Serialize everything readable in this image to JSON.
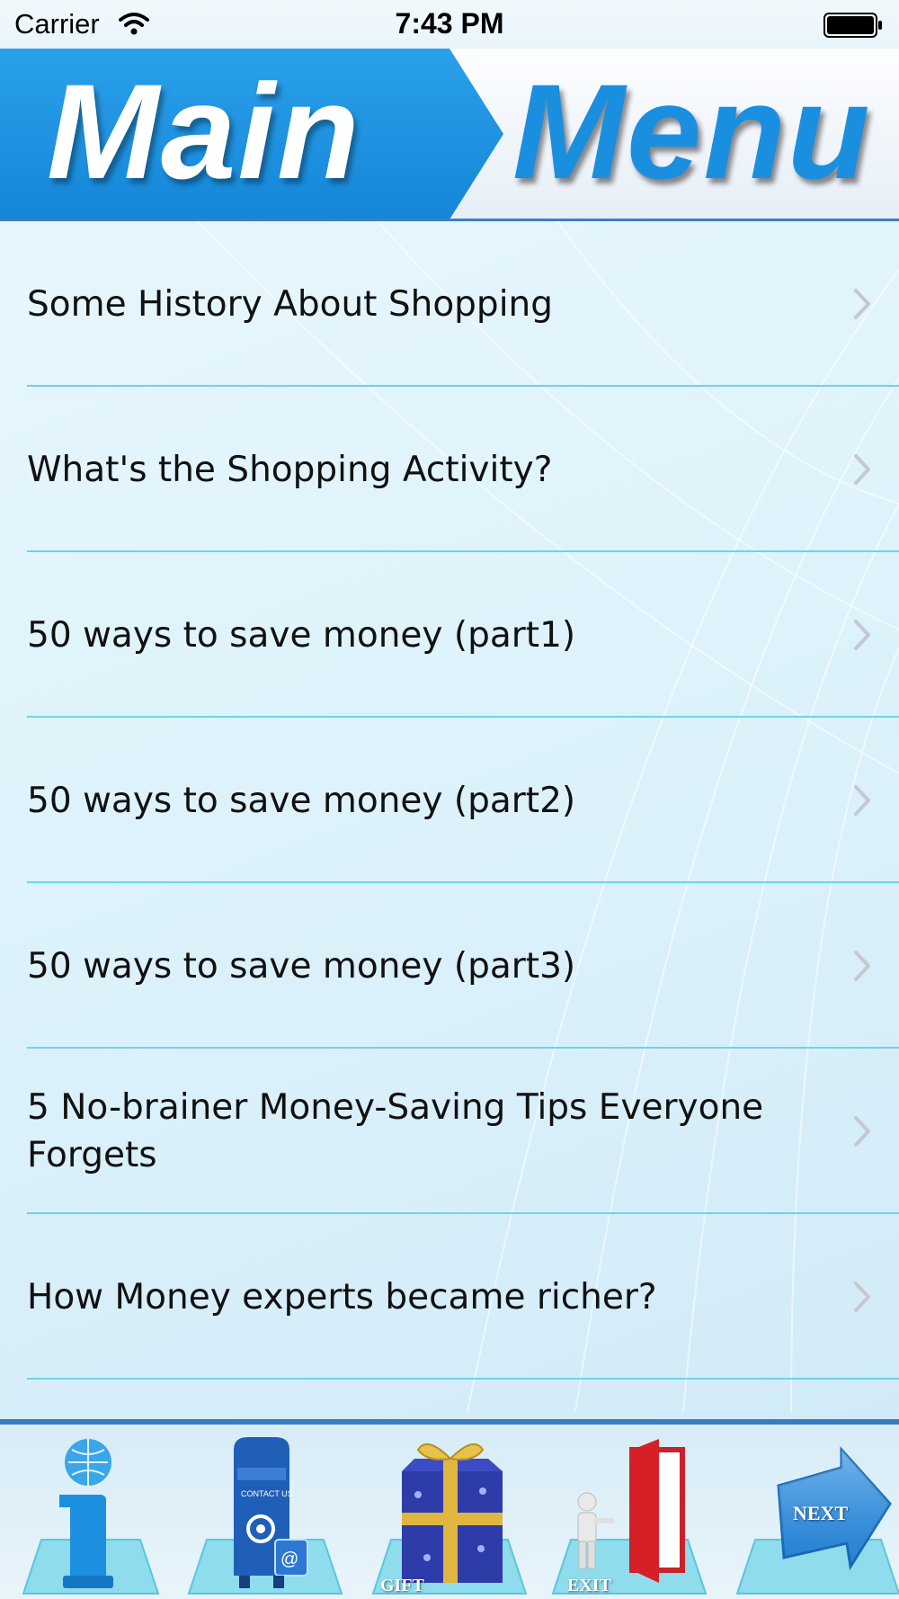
{
  "status_bar": {
    "carrier": "Carrier",
    "time": "7:43 PM"
  },
  "header": {
    "word1": "Main",
    "word2": "Menu"
  },
  "menu": {
    "items": [
      {
        "label": "Some History About Shopping"
      },
      {
        "label": "What's the Shopping Activity?"
      },
      {
        "label": "50 ways to save money (part1)"
      },
      {
        "label": "50 ways to save money (part2)"
      },
      {
        "label": "50 ways to save money (part3)"
      },
      {
        "label": "5 No-brainer Money-Saving Tips Everyone Forgets"
      },
      {
        "label": "How Money experts became richer?"
      }
    ]
  },
  "toolbar": {
    "info_icon": "info-icon",
    "contact_label": "CONTACT US",
    "gift_label": "GIFT",
    "exit_label": "EXIT",
    "next_label": "NEXT"
  },
  "colors": {
    "header_blue": "#1a8fe0",
    "divider": "#6fd3e6",
    "toolbar_border": "#3a7cc2"
  }
}
